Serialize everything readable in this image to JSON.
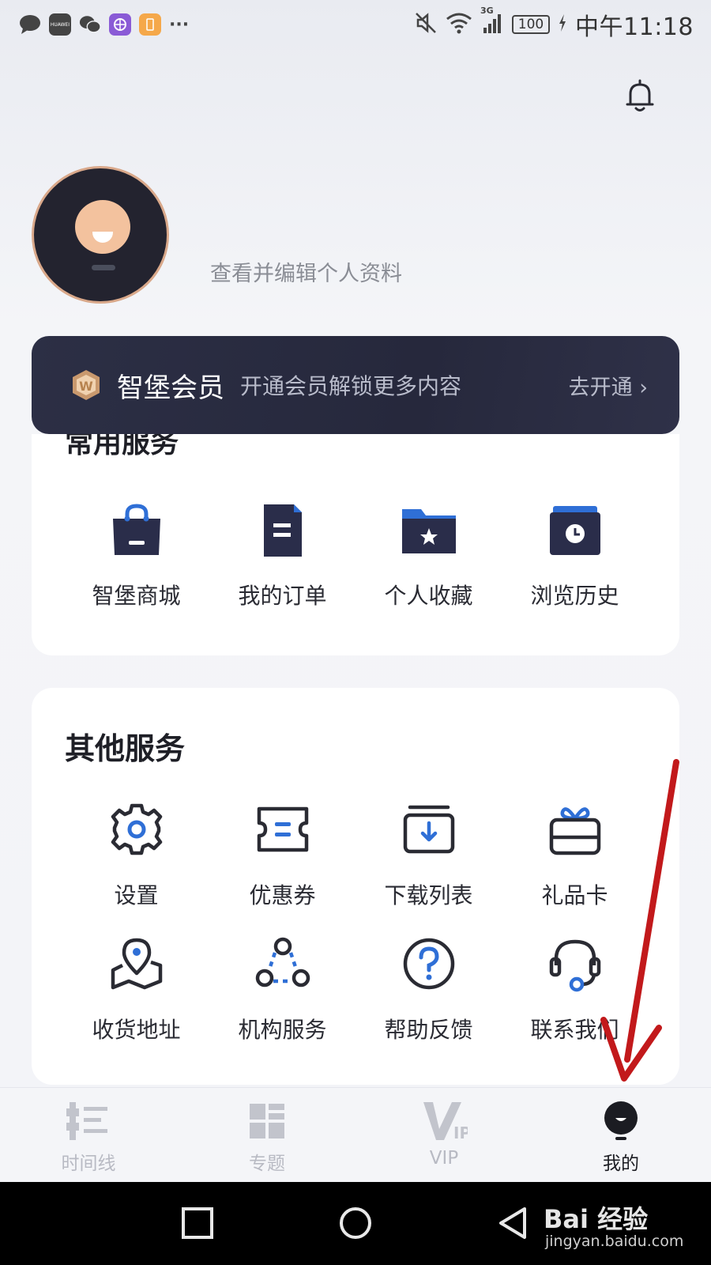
{
  "status_bar": {
    "time": "中午11:18",
    "battery": "100",
    "network": "3G",
    "app_icons": [
      "message-icon",
      "huawei-icon",
      "wechat-icon",
      "purple-app-icon",
      "orange-app-icon"
    ],
    "huawei_label": "HUAWEI",
    "more": "···"
  },
  "profile": {
    "hint": "查看并编辑个人资料"
  },
  "vip_banner": {
    "title": "智堡会员",
    "description": "开通会员解锁更多内容",
    "cta": "去开通 ›"
  },
  "common_services": {
    "title": "常用服务",
    "items": [
      {
        "label": "智堡商城",
        "icon": "shopping-bag-icon"
      },
      {
        "label": "我的订单",
        "icon": "order-document-icon"
      },
      {
        "label": "个人收藏",
        "icon": "favorite-folder-icon"
      },
      {
        "label": "浏览历史",
        "icon": "history-calendar-icon"
      }
    ]
  },
  "other_services": {
    "title": "其他服务",
    "items": [
      {
        "label": "设置",
        "icon": "gear-icon"
      },
      {
        "label": "优惠券",
        "icon": "coupon-icon"
      },
      {
        "label": "下载列表",
        "icon": "download-icon"
      },
      {
        "label": "礼品卡",
        "icon": "gift-card-icon"
      },
      {
        "label": "收货地址",
        "icon": "location-pin-icon"
      },
      {
        "label": "机构服务",
        "icon": "organization-icon"
      },
      {
        "label": "帮助反馈",
        "icon": "help-icon"
      },
      {
        "label": "联系我们",
        "icon": "headset-icon"
      }
    ]
  },
  "tab_bar": {
    "tabs": [
      {
        "label": "时间线",
        "icon": "timeline-icon",
        "active": false
      },
      {
        "label": "专题",
        "icon": "topics-grid-icon",
        "active": false
      },
      {
        "label": "VIP",
        "icon": "vip-icon",
        "active": false
      },
      {
        "label": "我的",
        "icon": "profile-icon",
        "active": true
      }
    ]
  },
  "watermark": {
    "brand": "Bai 经验",
    "url": "jingyan.baidu.com"
  },
  "colors": {
    "accent_blue": "#2f6fd6",
    "dark_navy": "#2a2d4a",
    "vip_bg": "#2a2c42",
    "arrow_red": "#c2191b"
  }
}
